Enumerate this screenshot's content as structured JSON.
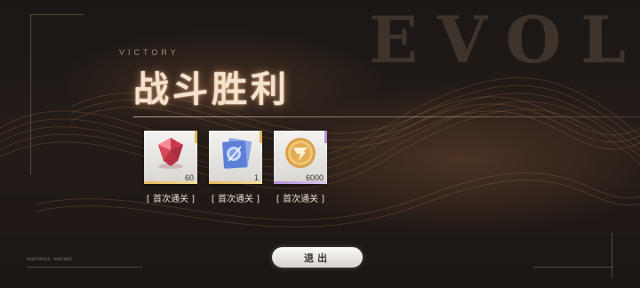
{
  "watermark": "EVOL",
  "header": {
    "victory_label": "VICTORY",
    "title": "战斗胜利"
  },
  "side_text": {
    "left_code": "DEEPSPACE HUNTERS"
  },
  "rewards": [
    {
      "icon": "red-gem-icon",
      "count": "60",
      "label": "[ 首次通关 ]",
      "rarity_color": "#e2b85a"
    },
    {
      "icon": "blue-ticket-icon",
      "count": "1",
      "label": "[ 首次通关 ]",
      "rarity_color": "#e2b85a"
    },
    {
      "icon": "gold-coin-icon",
      "count": "6000",
      "label": "[ 首次通关 ]",
      "rarity_color": "#b58fd6"
    }
  ],
  "exit_button": {
    "label": "退出"
  }
}
